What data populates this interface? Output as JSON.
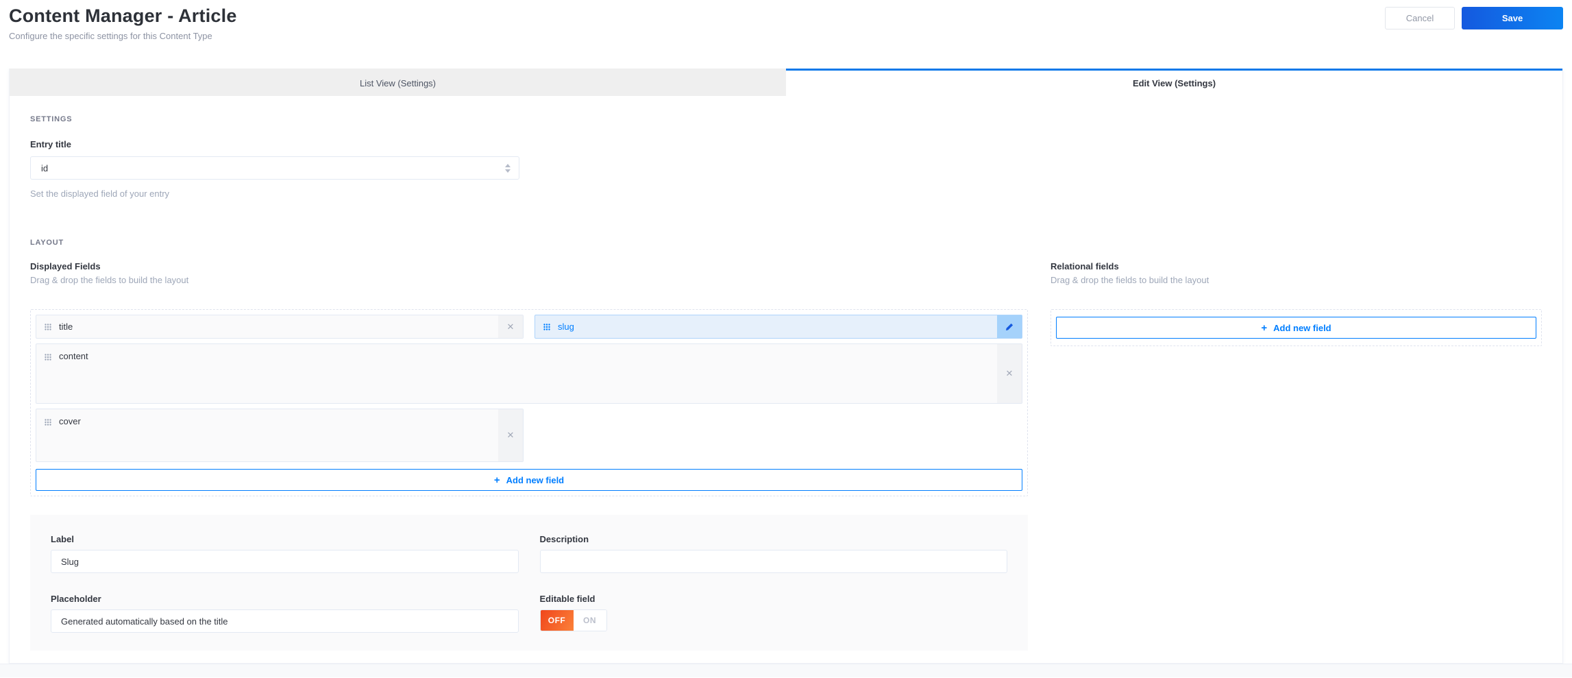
{
  "header": {
    "title": "Content Manager - Article",
    "subtitle": "Configure the specific settings for this Content Type",
    "cancel_label": "Cancel",
    "save_label": "Save"
  },
  "tabs": [
    {
      "label": "List View (Settings)",
      "active": false
    },
    {
      "label": "Edit View (Settings)",
      "active": true
    }
  ],
  "settings_section": {
    "heading": "SETTINGS",
    "entry_title": {
      "label": "Entry title",
      "value": "id",
      "help": "Set the displayed field of your entry"
    }
  },
  "layout_section": {
    "heading": "LAYOUT",
    "displayed_fields": {
      "title": "Displayed Fields",
      "subtitle": "Drag & drop the fields to build the layout",
      "fields": [
        {
          "name": "title",
          "size": "half",
          "selected": false
        },
        {
          "name": "slug",
          "size": "half",
          "selected": true
        },
        {
          "name": "content",
          "size": "full",
          "selected": false
        },
        {
          "name": "cover",
          "size": "half",
          "selected": false
        }
      ],
      "add_button_label": "Add new field"
    },
    "relational_fields": {
      "title": "Relational fields",
      "subtitle": "Drag & drop the fields to build the layout",
      "add_button_label": "Add new field"
    }
  },
  "field_form": {
    "label": {
      "label": "Label",
      "value": "Slug"
    },
    "description": {
      "label": "Description",
      "value": ""
    },
    "placeholder": {
      "label": "Placeholder",
      "value": "Generated automatically based on the title"
    },
    "editable": {
      "label": "Editable field",
      "off_label": "OFF",
      "on_label": "ON",
      "selected": "OFF"
    }
  },
  "colors": {
    "accent_blue": "#007eff",
    "active_tab_border": "#0e79e9",
    "selected_chip_bg": "#e6f0fb",
    "selected_chip_border": "#aed4fb",
    "save_gradient_start": "#1459df",
    "save_gradient_end": "#0c84f2",
    "toggle_off_start": "#f0461c",
    "toggle_off_end": "#fb8139"
  }
}
